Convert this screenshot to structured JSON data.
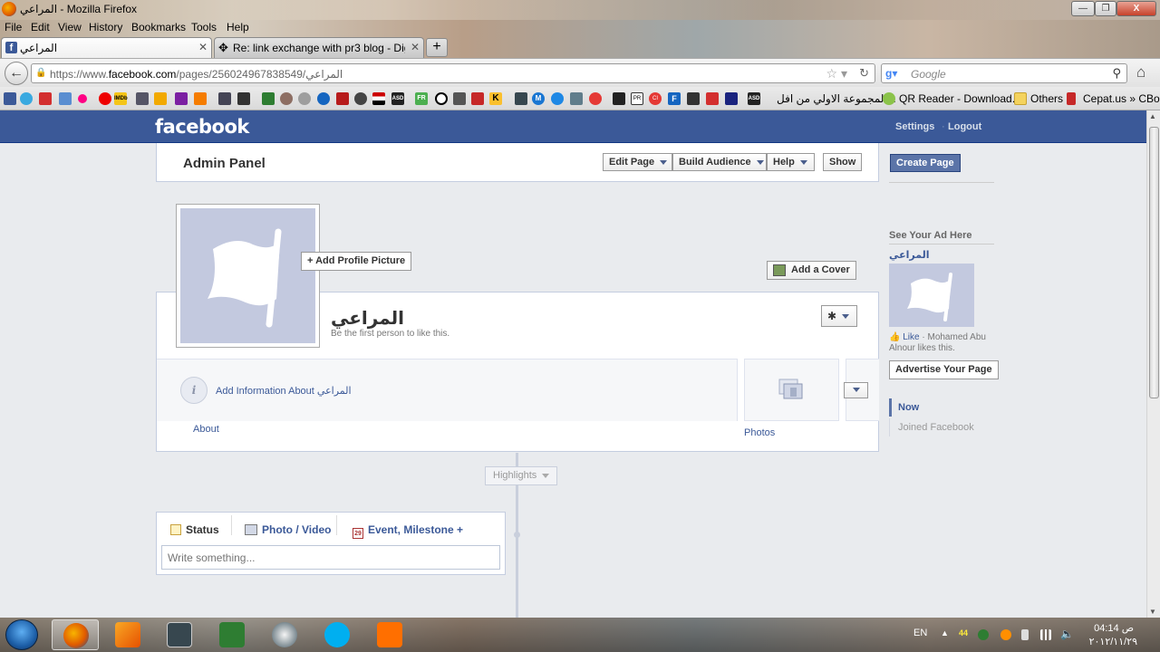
{
  "window": {
    "title": "المراعي - Mozilla Firefox",
    "controls": {
      "minimize": "—",
      "maximize": "❐",
      "close": "X"
    }
  },
  "menubar": [
    "File",
    "Edit",
    "View",
    "History",
    "Bookmarks",
    "Tools",
    "Help"
  ],
  "tabs": [
    {
      "label": "المراعي",
      "active": true
    },
    {
      "label": "Re: link exchange with pr3 blog - Digi...",
      "active": false
    }
  ],
  "navbar": {
    "url_prefix": "https://www.",
    "url_domain": "facebook.com",
    "url_rest": "/pages/المراعي/256024967838549",
    "search_placeholder": "Google"
  },
  "bookmarks": {
    "text_items": [
      "المجموعة الاولي من افل...",
      "QR Reader - Download...",
      "Others",
      "Cepat.us » CBox"
    ],
    "icon_labels": {
      "imdb": "IMDb",
      "asd1": "ASD",
      "fr": "FR",
      "asd2": "ASD",
      "k": "K",
      "m": "M",
      "f": "F",
      "c": "CI",
      "pr": "PR"
    }
  },
  "facebook": {
    "logo": "facebook",
    "settings": "Settings",
    "separator": "·",
    "logout": "Logout",
    "admin_panel": {
      "title": "Admin Panel",
      "edit_page": "Edit Page",
      "build_audience": "Build Audience",
      "help": "Help",
      "show": "Show"
    },
    "create_page": "Create Page",
    "add_profile_picture": "+ Add Profile Picture",
    "add_cover": "Add a Cover",
    "page_name": "المراعي",
    "like_line": "Be the first person to like this.",
    "gear": "✱",
    "add_info": "Add Information About المراعي",
    "about": "About",
    "photos": "Photos",
    "highlights": "Highlights",
    "composer": {
      "status": "Status",
      "photo_video": "Photo / Video",
      "event": "Event, Milestone +",
      "event_icon": "29",
      "placeholder": "Write something..."
    },
    "right_column": {
      "see_ad": "See Your Ad Here",
      "ad_name": "المراعي",
      "like": "Like",
      "like_text": "· Mohamed Abu Alnour likes this.",
      "advertise": "Advertise Your Page",
      "now": "Now",
      "joined": "Joined Facebook"
    }
  },
  "taskbar": {
    "language": "EN",
    "tray_number": "44",
    "time": "04:14 ص",
    "date": "٢٠١٢/١١/٢٩"
  },
  "colors": {
    "fb_blue": "#3b5998",
    "fb_link": "#3b5998",
    "page_bg": "#e9ebee"
  }
}
